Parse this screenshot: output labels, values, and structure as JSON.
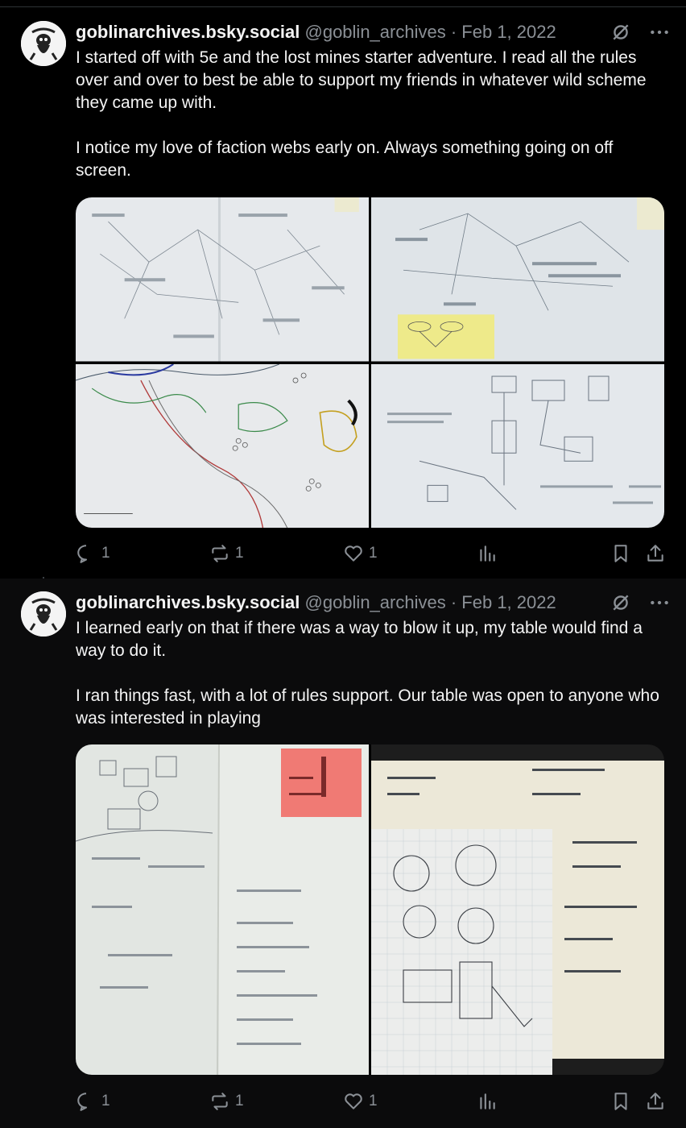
{
  "posts": [
    {
      "author": {
        "display_name": "goblinarchives.bsky.social",
        "handle": "@goblin_archives",
        "separator": "·",
        "date": "Feb 1, 2022"
      },
      "paragraphs": [
        "I started off with 5e and the lost mines starter adventure. I read all the rules over and over to best be able to support my friends in whatever wild scheme they came up with.",
        "I notice my love of faction webs early on. Always something going on off screen."
      ],
      "images": [
        {
          "icon": "photo-faction-web-notebook"
        },
        {
          "icon": "photo-faction-web-with-yellow-note"
        },
        {
          "icon": "photo-hand-drawn-map"
        },
        {
          "icon": "photo-dungeon-sketch"
        }
      ],
      "actions": {
        "replies": "1",
        "reposts": "1",
        "likes": "1"
      }
    },
    {
      "author": {
        "display_name": "goblinarchives.bsky.social",
        "handle": "@goblin_archives",
        "separator": "·",
        "date": "Feb 1, 2022"
      },
      "paragraphs": [
        "I learned early on that if there was a way to blow it up, my table would find a way to do it.",
        "I ran things fast, with a lot of rules support. Our table was open to anyone who was interested in playing"
      ],
      "images": [
        {
          "icon": "photo-notebook-with-pink-note"
        },
        {
          "icon": "photo-notebook-grid-map"
        }
      ],
      "actions": {
        "replies": "1",
        "reposts": "1",
        "likes": "1"
      }
    }
  ],
  "colors": {
    "background": "#000000",
    "text": "#e7e9ea",
    "muted": "#8b9096",
    "divider": "#2f3336",
    "paper": "#e9ecee",
    "sticky_yellow": "#eeea8a",
    "sticky_pink": "#f07a74"
  }
}
